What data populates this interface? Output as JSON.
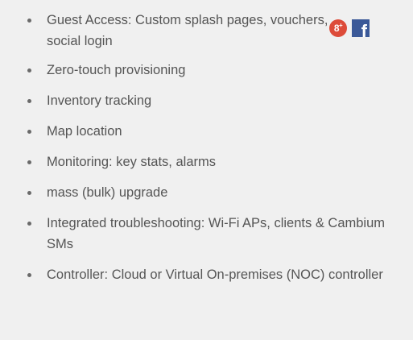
{
  "features": [
    {
      "text": "Guest Access: Custom splash pages, vouchers, social login"
    },
    {
      "text": "Zero-touch provisioning"
    },
    {
      "text": "Inventory tracking"
    },
    {
      "text": "Map location"
    },
    {
      "text": "Monitoring: key stats, alarms"
    },
    {
      "text": "mass (bulk) upgrade"
    },
    {
      "text": "Integrated troubleshooting: Wi-Fi APs, clients & Cambium SMs"
    },
    {
      "text": "Controller: Cloud or Virtual On-premises (NOC) controller"
    }
  ],
  "social_icons": {
    "gplus_glyph": "8",
    "gplus_sup": "+",
    "facebook_glyph": "f",
    "gplus_color": "#dd4b39",
    "facebook_color": "#3b5998"
  }
}
